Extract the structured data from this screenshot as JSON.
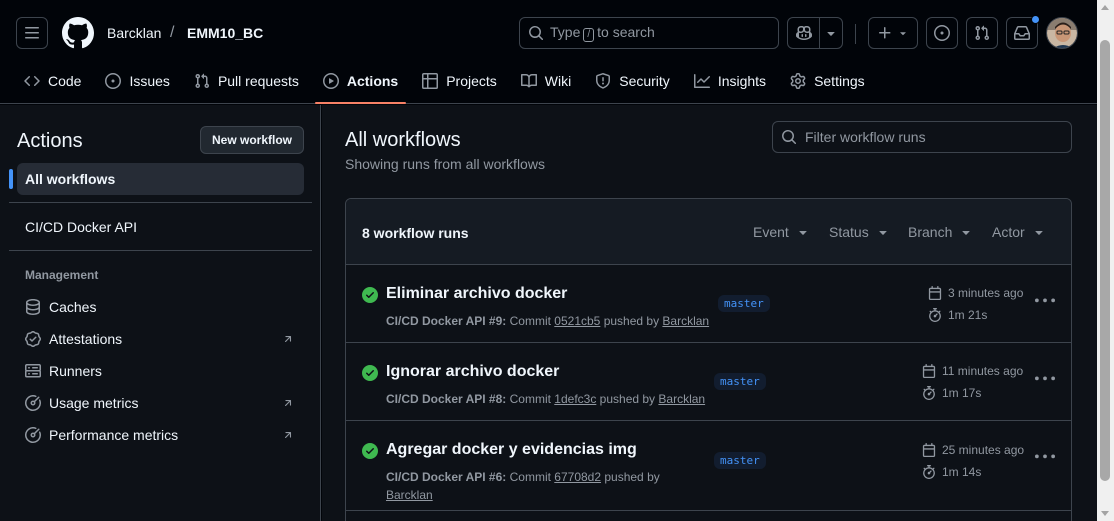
{
  "header": {
    "owner": "Barcklan",
    "separator": "/",
    "repo": "EMM10_BC",
    "search_prefix": "Type",
    "search_key": "/",
    "search_suffix": "to search"
  },
  "tabs": [
    {
      "label": "Code",
      "icon": "code-icon"
    },
    {
      "label": "Issues",
      "icon": "issue-icon"
    },
    {
      "label": "Pull requests",
      "icon": "pull-request-icon"
    },
    {
      "label": "Actions",
      "icon": "play-icon",
      "active": true
    },
    {
      "label": "Projects",
      "icon": "table-icon"
    },
    {
      "label": "Wiki",
      "icon": "book-icon"
    },
    {
      "label": "Security",
      "icon": "shield-icon"
    },
    {
      "label": "Insights",
      "icon": "graph-icon"
    },
    {
      "label": "Settings",
      "icon": "gear-icon"
    }
  ],
  "sidebar": {
    "title": "Actions",
    "new_workflow": "New workflow",
    "all_workflows": "All workflows",
    "workflows": [
      "CI/CD Docker API"
    ],
    "management_heading": "Management",
    "management": [
      {
        "label": "Caches",
        "icon": "database-icon"
      },
      {
        "label": "Attestations",
        "icon": "verified-icon",
        "external": true
      },
      {
        "label": "Runners",
        "icon": "server-icon"
      },
      {
        "label": "Usage metrics",
        "icon": "meter-icon",
        "external": true
      },
      {
        "label": "Performance metrics",
        "icon": "meter-icon",
        "external": true
      }
    ]
  },
  "main": {
    "title": "All workflows",
    "subtitle": "Showing runs from all workflows",
    "filter_placeholder": "Filter workflow runs",
    "runs_count": "8 workflow runs",
    "filters": [
      "Event",
      "Status",
      "Branch",
      "Actor"
    ],
    "runs": [
      {
        "title": "Eliminar archivo docker",
        "workflow": "CI/CD Docker API #9:",
        "commit_label": "Commit",
        "commit": "0521cb5",
        "pushed_by": "pushed by",
        "user": "Barcklan",
        "branch": "master",
        "when": "3 minutes ago",
        "duration": "1m 21s",
        "status": "success"
      },
      {
        "title": "Ignorar archivo docker",
        "workflow": "CI/CD Docker API #8:",
        "commit_label": "Commit",
        "commit": "1defc3c",
        "pushed_by": "pushed by",
        "user": "Barcklan",
        "branch": "master",
        "when": "11 minutes ago",
        "duration": "1m 17s",
        "status": "success"
      },
      {
        "title": "Agregar docker y evidencias img",
        "workflow": "CI/CD Docker API #6:",
        "commit_label": "Commit",
        "commit": "67708d2",
        "pushed_by": "pushed by",
        "user": "Barcklan",
        "branch": "master",
        "when": "25 minutes ago",
        "duration": "1m 14s",
        "status": "success"
      }
    ]
  },
  "colors": {
    "success": "#3fb950",
    "accent": "#4493f8",
    "active_tab_underline": "#f78166"
  }
}
